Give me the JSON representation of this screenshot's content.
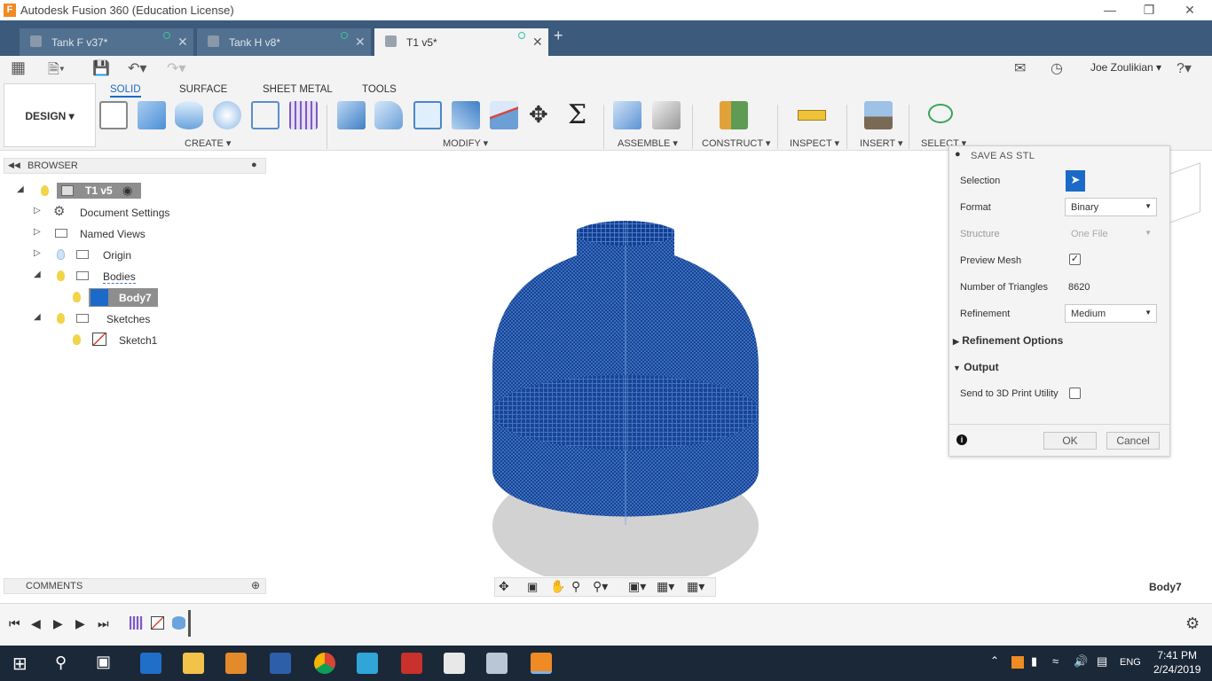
{
  "window": {
    "title": "Autodesk Fusion 360 (Education License)"
  },
  "tabs": [
    {
      "label": "Tank F v37*"
    },
    {
      "label": "Tank H v8*"
    },
    {
      "label": "T1 v5*"
    }
  ],
  "user": {
    "name": "Joe Zoulikian"
  },
  "ribbon": {
    "design_label": "DESIGN",
    "tabs": [
      "SOLID",
      "SURFACE",
      "SHEET METAL",
      "TOOLS"
    ],
    "groups": [
      "CREATE",
      "MODIFY",
      "ASSEMBLE",
      "CONSTRUCT",
      "INSPECT",
      "INSERT",
      "SELECT"
    ]
  },
  "browser": {
    "header": "BROWSER",
    "root": "T1 v5",
    "items": [
      "Document Settings",
      "Named Views",
      "Origin",
      "Bodies",
      "Body7",
      "Sketches",
      "Sketch1"
    ]
  },
  "comments": {
    "header": "COMMENTS"
  },
  "status": {
    "selected": "Body7"
  },
  "dialog": {
    "title": "SAVE AS STL",
    "selection_label": "Selection",
    "format_label": "Format",
    "format_value": "Binary",
    "structure_label": "Structure",
    "structure_value": "One File",
    "preview_label": "Preview Mesh",
    "preview_checked": true,
    "triangles_label": "Number of Triangles",
    "triangles_value": "8620",
    "refinement_label": "Refinement",
    "refinement_value": "Medium",
    "refinement_options_label": "Refinement Options",
    "output_label": "Output",
    "send_label": "Send to 3D Print Utility",
    "send_checked": false,
    "ok_label": "OK",
    "cancel_label": "Cancel"
  },
  "taskbar": {
    "language": "ENG",
    "time": "7:41 PM",
    "date": "2/24/2019"
  },
  "colors": {
    "tabbar": "#3b5a7c",
    "accent": "#1b6ac9",
    "mesh": "#0d3b8c",
    "taskbar": "#1b2838"
  }
}
